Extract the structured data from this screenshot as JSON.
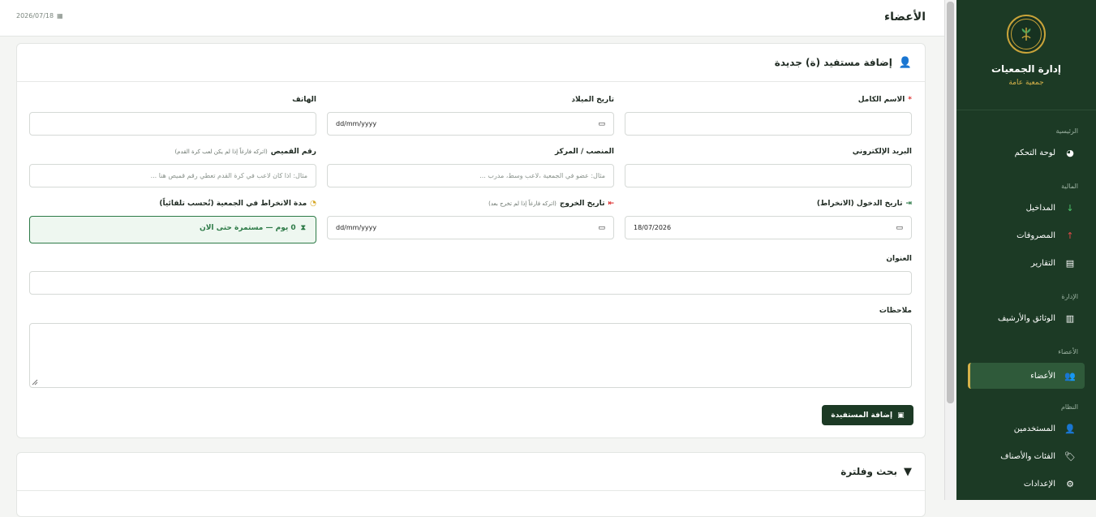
{
  "sidebar": {
    "brand_title": "إدارة الجمعيات",
    "brand_sub": "جمعية عامة",
    "sections": {
      "home": "الرئيسية",
      "finance": "المالية",
      "admin": "الإدارة",
      "members": "الأعضاء",
      "system": "النظام"
    },
    "items": [
      {
        "label": "لوحة التحكم",
        "icon": "pie-chart-icon"
      },
      {
        "label": "المداخيل",
        "icon": "arrow-down-icon"
      },
      {
        "label": "المصروفات",
        "icon": "arrow-up-icon"
      },
      {
        "label": "التقارير",
        "icon": "file-report-icon"
      },
      {
        "label": "الوثائق والأرشيف",
        "icon": "document-icon"
      },
      {
        "label": "الأعضاء",
        "icon": "users-icon"
      },
      {
        "label": "المستخدمين",
        "icon": "user-gear-icon"
      },
      {
        "label": "الفئات والأصناف",
        "icon": "tags-icon"
      },
      {
        "label": "الإعدادات",
        "icon": "gear-icon"
      }
    ],
    "active_item": "الأعضاء",
    "accent": "#d6b24a"
  },
  "header": {
    "title": "الأعضاء",
    "date": "2026/07/18"
  },
  "form": {
    "title": "إضافة مستفيد (ة) جديدة",
    "full_name": {
      "label": "الاسم الكامل",
      "value": ""
    },
    "birth_date": {
      "label": "تاريخ الميلاد",
      "placeholder": "dd/mm/yyyy"
    },
    "phone": {
      "label": "الهاتف",
      "value": ""
    },
    "email": {
      "label": "البريد الإلكتروني",
      "value": ""
    },
    "position": {
      "label": "المنصب / المركز",
      "placeholder": "مثال: عضو في الجمعية ،لاعب وسط، مدرب ..."
    },
    "shirt_number": {
      "label": "رقم القميص",
      "hint": "(اتركه فارغاً إذا لم يكن لعب كرة القدم)",
      "placeholder": "مثال: اذا كان لاعب في كرة القدم تعطي رقم قميص هنا ..."
    },
    "entry_date": {
      "label": "تاريخ الدخول (الانخراط)",
      "value": "18/07/2026"
    },
    "exit_date": {
      "label": "تاريخ الخروج",
      "hint": "(اتركه فارغاً إذا لم تخرج بعد)",
      "placeholder": "dd/mm/yyyy"
    },
    "duration": {
      "label": "مدة الانخراط في الجمعية (تُحسب تلقائياً)",
      "value": "0 يوم — مستمرة حتى الان"
    },
    "address": {
      "label": "العنوان",
      "value": ""
    },
    "notes": {
      "label": "ملاحظات",
      "value": ""
    },
    "submit_label": "إضافة المستفيدة"
  },
  "filter": {
    "title": "بحث وفلترة"
  }
}
